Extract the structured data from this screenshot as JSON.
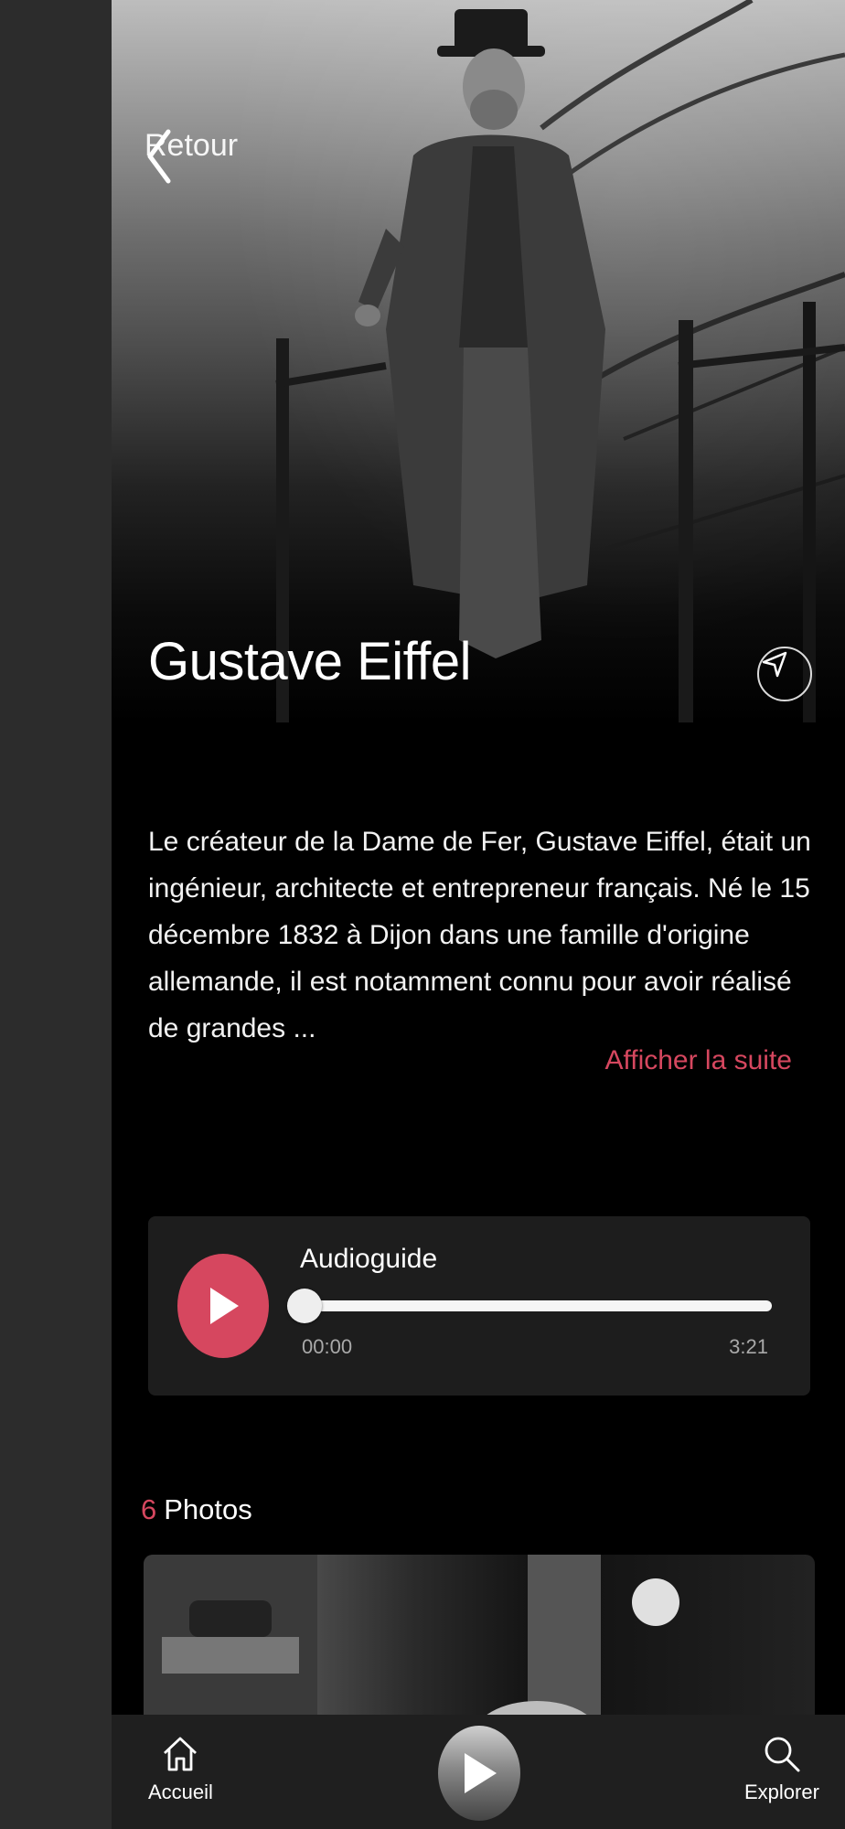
{
  "header": {
    "back_label": "Retour"
  },
  "hero": {
    "title": "Gustave Eiffel"
  },
  "description": {
    "text": "Le créateur de la Dame de Fer, Gustave Eiffel, était un ingénieur, architecte et entrepreneur français. Né le 15 décembre 1832 à Dijon dans une famille d'origine allemande, il est notamment connu pour avoir réalisé de grandes ...",
    "more_label": "Afficher la suite"
  },
  "audio": {
    "title": "Audioguide",
    "current_time": "00:00",
    "duration": "3:21",
    "progress": 0
  },
  "photos": {
    "count": "6",
    "label": "Photos"
  },
  "tabbar": {
    "home_label": "Accueil",
    "explore_label": "Explorer"
  },
  "colors": {
    "accent": "#d6475f",
    "background": "#000000",
    "card": "#1d1d1d"
  },
  "icons": [
    "chevron-left-icon",
    "navigation-arrow-icon",
    "play-icon",
    "home-icon",
    "search-icon"
  ]
}
